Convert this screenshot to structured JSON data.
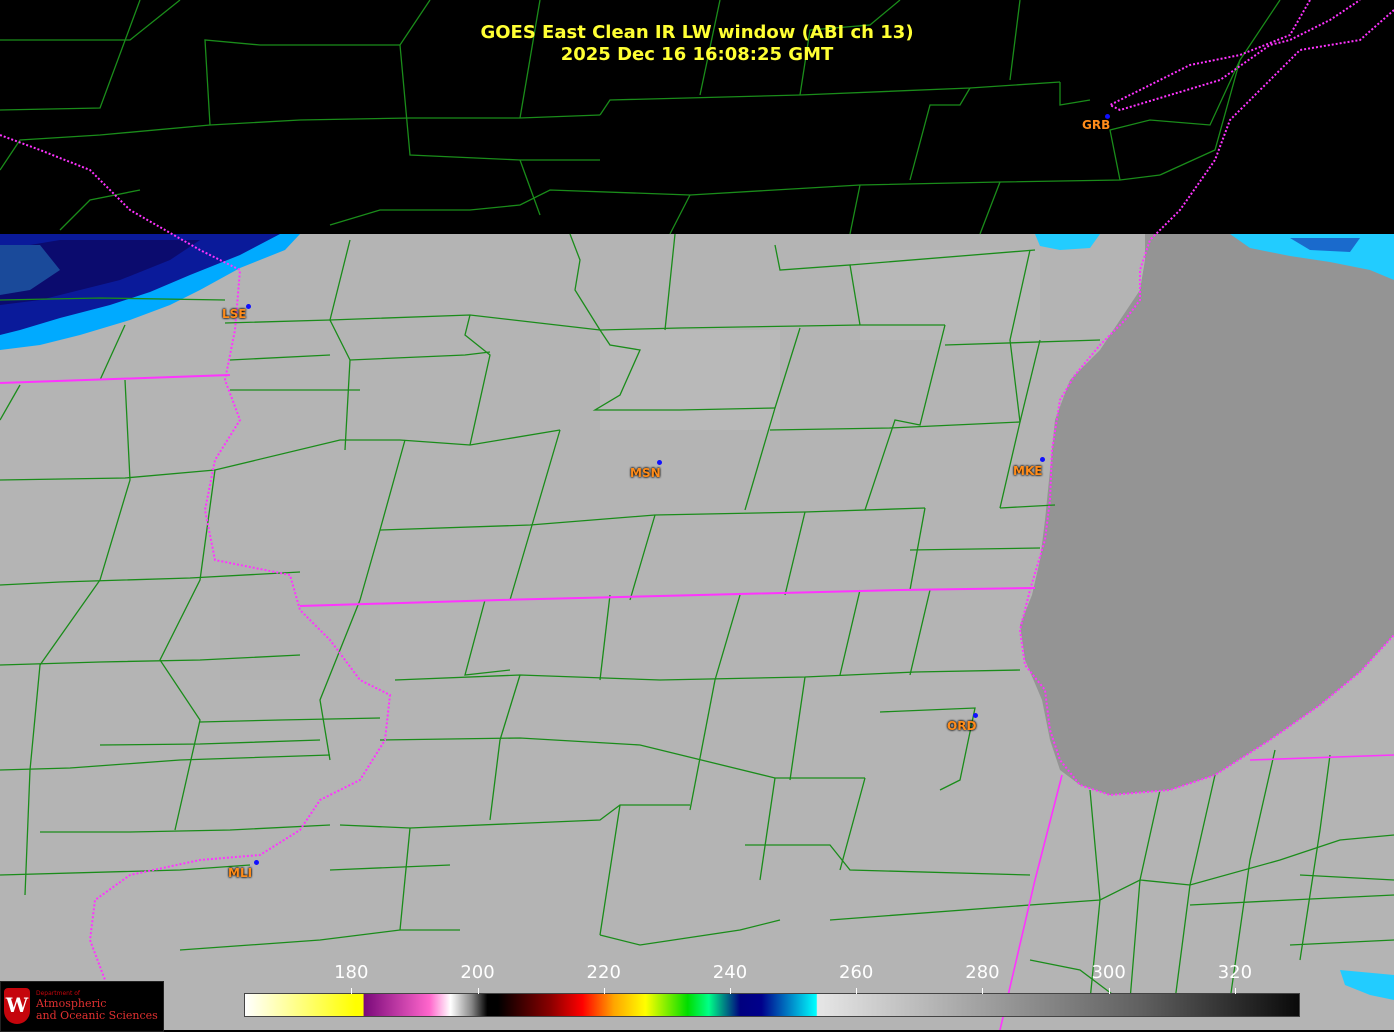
{
  "title": {
    "line1": "GOES East Clean IR LW window (ABI ch 13)",
    "line2": "2025 Dec 16  16:08:25 GMT"
  },
  "colors": {
    "title": "#ffff33",
    "county_lines": "#1a8c1a",
    "state_lines": "#ff33ff",
    "city_label": "#ff8c1a",
    "station_dot": "#1010ff",
    "no_data": "#000000",
    "clear_sky_gray": "#b4b4b4",
    "lake_gray": "#949494"
  },
  "cities": [
    {
      "id": "GRB",
      "label": "GRB"
    },
    {
      "id": "LSE",
      "label": "LSE"
    },
    {
      "id": "MSN",
      "label": "MSN"
    },
    {
      "id": "MKE",
      "label": "MKE"
    },
    {
      "id": "ORD",
      "label": "ORD"
    },
    {
      "id": "MLI",
      "label": "MLI"
    }
  ],
  "colorbar": {
    "ticks": [
      "180",
      "200",
      "220",
      "240",
      "260",
      "280",
      "300",
      "320"
    ],
    "min": 163,
    "max": 330
  },
  "logo": {
    "line1": "Department of",
    "line2": "Atmospheric",
    "line3": "and Oceanic Sciences",
    "shield_letter": "W"
  }
}
